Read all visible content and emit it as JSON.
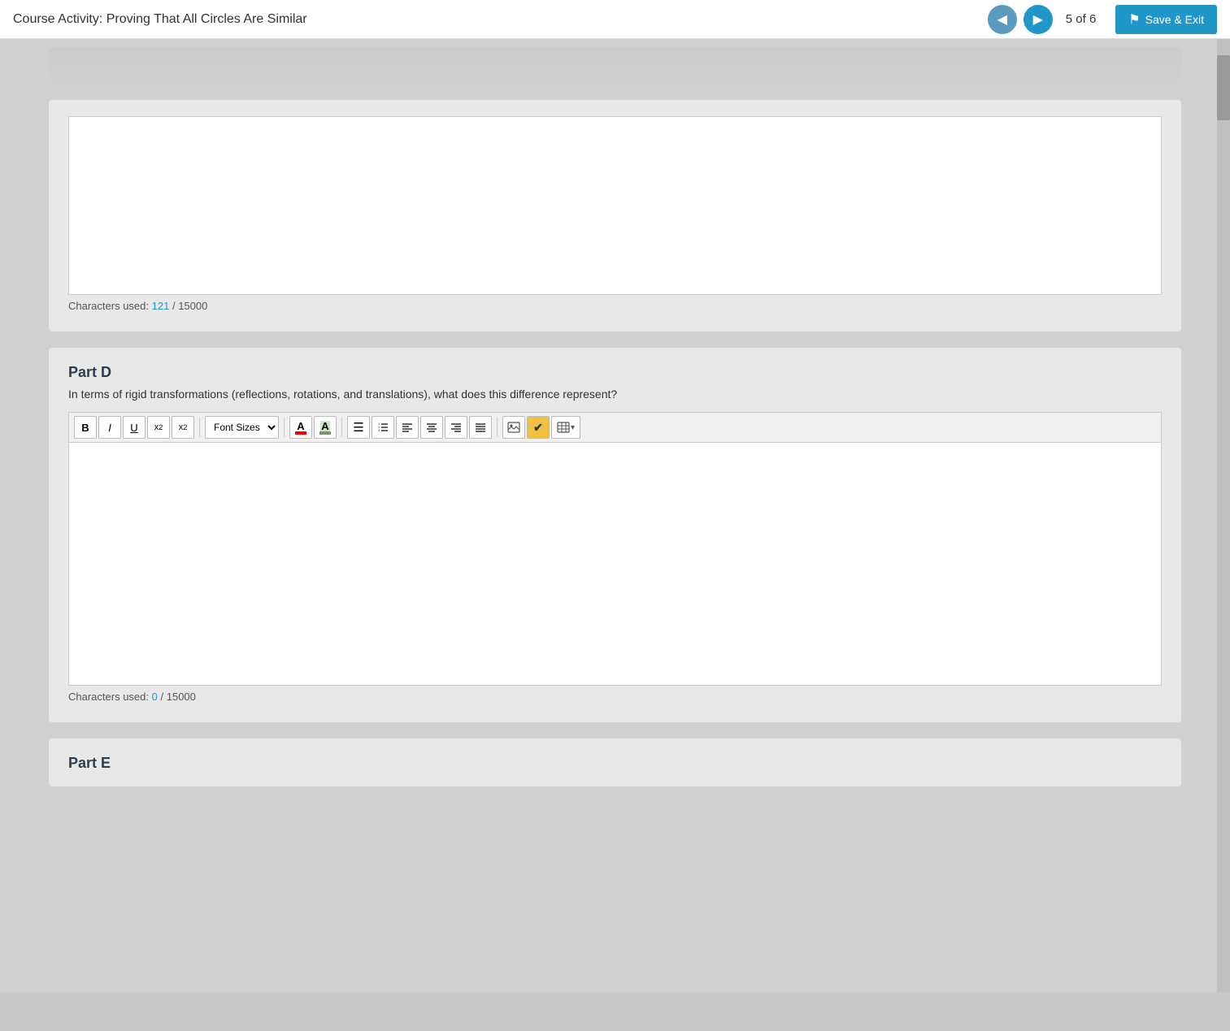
{
  "header": {
    "title": "Course Activity: Proving That All Circles Are Similar",
    "prev_label": "◀",
    "next_label": "▶",
    "page_current": "5",
    "page_of": "of",
    "page_total": "6",
    "save_exit_label": "Save & Exit"
  },
  "top_section": {
    "chars_used_label": "Characters used:",
    "chars_used_count": "121",
    "chars_used_separator": "/",
    "chars_max": "15000"
  },
  "part_d": {
    "title": "Part D",
    "question": "In terms of rigid transformations (reflections, rotations, and translations), what does this difference represent?",
    "chars_used_label": "Characters used:",
    "chars_used_count": "0",
    "chars_used_separator": "/",
    "chars_max": "15000"
  },
  "part_e": {
    "title": "Part E"
  },
  "toolbar": {
    "bold": "B",
    "italic": "I",
    "underline": "U",
    "superscript": "x²",
    "subscript": "x₂",
    "font_sizes_placeholder": "Font Sizes",
    "font_color": "A",
    "bg_color": "A",
    "bullet_list": "≡",
    "numbered_list": "≡",
    "align_left": "≡",
    "align_center": "≡",
    "align_right": "≡",
    "align_justify": "≡",
    "insert_image": "🖼",
    "checkmark": "✔",
    "insert_table": "⊞"
  }
}
